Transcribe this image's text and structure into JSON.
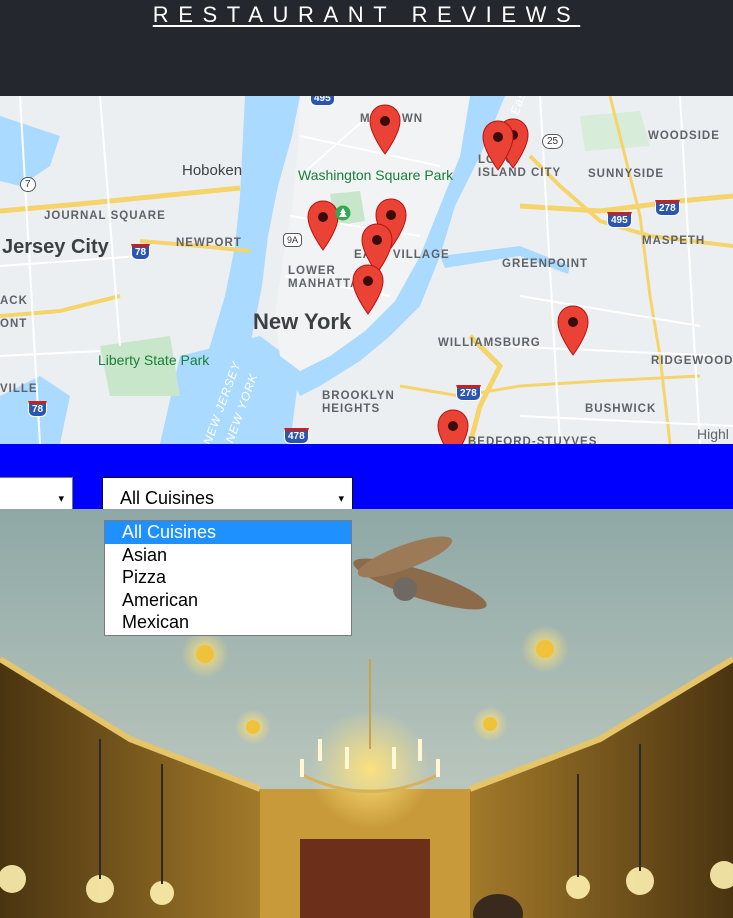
{
  "header": {
    "title": "RESTAURANT REVIEWS"
  },
  "map": {
    "labels": {
      "hoboken": "Hoboken",
      "journal_square": "JOURNAL SQUARE",
      "jersey_city": "Jersey City",
      "newport": "NEWPORT",
      "washington_square_park": "Washington Square Park",
      "east_village": "EAST VILLAGE",
      "lower_manhattan": "LOWER MANHATTAN",
      "new_york": "New York",
      "liberty_state_park": "Liberty State Park",
      "brooklyn_heights": "BROOKLYN HEIGHTS",
      "williamsburg": "WILLIAMSBURG",
      "greenpoint": "GREENPOINT",
      "long_island_city": "LONG ISLAND CITY",
      "sunnyside": "SUNNYSIDE",
      "woodside": "WOODSIDE",
      "maspeth": "MASPETH",
      "ridgewood": "RIDGEWOOD",
      "bushwick": "BUSHWICK",
      "bedford_stuyvesant": "BEDFORD-STUYVES",
      "midtown": "MIDTOWN",
      "new_jersey": "NEW JERSEY",
      "new_york_water": "NEW YORK",
      "east_river": "East",
      "highland": "Highl",
      "hack": "ACK",
      "ont": "ONT",
      "ville": "VILLE"
    },
    "shields": {
      "i495_top": "495",
      "i278_right": "278",
      "i495_right": "495",
      "i78_left": "78",
      "i78_bottom": "78",
      "i278_mid": "278",
      "i478": "478"
    },
    "routes": {
      "r25": "25",
      "r7": "7",
      "r9a": "9A"
    },
    "marker_count": 10
  },
  "filters": {
    "rating_select": {
      "value": "",
      "caret": "▾"
    },
    "cuisine_select": {
      "value": "All Cuisines",
      "caret": "▾"
    },
    "cuisine_options": [
      "All Cuisines",
      "Asian",
      "Pizza",
      "American",
      "Mexican"
    ],
    "selected_index": 0
  },
  "colors": {
    "header_bg": "#25272e",
    "filter_bar_bg": "#0000ff",
    "selected_option_bg": "#1e90ff",
    "marker_red": "#ea4335",
    "water": "#aadaff"
  }
}
